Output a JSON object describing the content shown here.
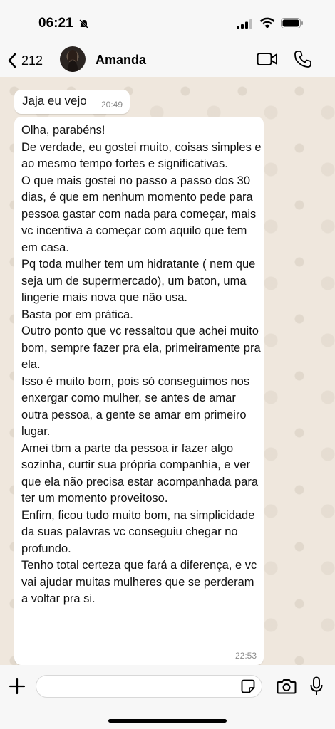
{
  "status_bar": {
    "time": "06:21"
  },
  "header": {
    "back_count": "212",
    "contact_name": "Amanda",
    "icons": [
      "chevron-left-icon",
      "video-call-icon",
      "phone-icon"
    ]
  },
  "messages": [
    {
      "text": "Jaja eu vejo",
      "time": "20:49"
    },
    {
      "text": "Olha, parabéns!\nDe verdade, eu gostei muito, coisas simples e ao mesmo tempo fortes e significativas.\nO que mais gostei no passo a passo dos 30 dias, é que em nenhum momento pede para pessoa gastar com nada para começar, mais vc incentiva a começar com aquilo que tem em casa.\nPq toda mulher tem um hidratante ( nem que seja um de supermercado), um baton, uma lingerie mais nova que não usa.\nBasta por em prática.\nOutro ponto que vc ressaltou que achei muito bom, sempre fazer pra ela, primeiramente pra ela.\nIsso é muito bom, pois só conseguimos nos enxergar como mulher, se antes de amar outra pessoa, a gente se amar em primeiro lugar.\nAmei tbm a parte da pessoa ir fazer algo sozinha, curtir sua própria companhia, e ver que ela não precisa estar acompanhada para ter um momento proveitoso.\nEnfim, ficou tudo muito bom, na simplicidade da suas palavras vc conseguiu chegar no profundo.\nTenho total certeza que fará a diferença, e vc vai ajudar muitas mulheres que se perderam a voltar pra si.",
      "time": "22:53"
    }
  ],
  "input": {
    "value": "",
    "placeholder": ""
  },
  "colors": {
    "accent": "#25d366",
    "bubble": "#ffffff",
    "chat_bg": "#efe7dd"
  }
}
